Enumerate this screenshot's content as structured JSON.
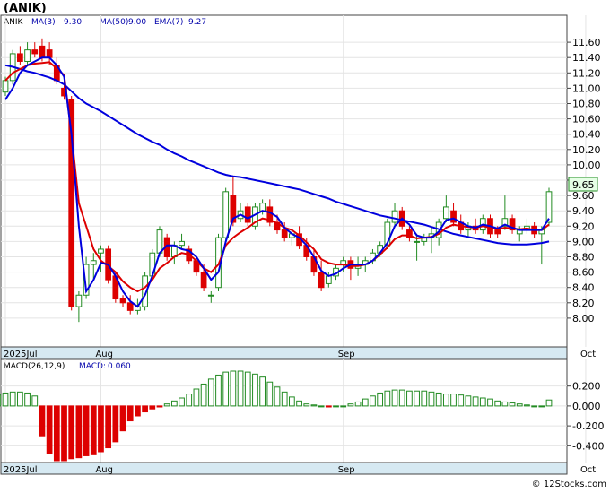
{
  "header": {
    "ticker": "(ANIK)",
    "legend": [
      {
        "text": "ANIK",
        "color": "#000000"
      },
      {
        "text": "MA(3)",
        "color": "#0000aa"
      },
      {
        "text": "9.30",
        "color": "#0000aa"
      },
      {
        "text": "MA(50)",
        "color": "#0000aa"
      },
      {
        "text": "9.00",
        "color": "#0000aa"
      },
      {
        "text": "EMA(7)",
        "color": "#0000aa"
      },
      {
        "text": "9.27",
        "color": "#0000aa"
      }
    ],
    "last_price_label": "9.65"
  },
  "footer": {
    "credit": "© 12Stocks.com"
  },
  "colors": {
    "up": "#228b22",
    "down": "#dd0000",
    "ma50": "#0000dd",
    "ema7": "#dd0000",
    "ma3": "#0000dd",
    "macd_pos": "#228b22",
    "macd_neg": "#dd0000",
    "axis_band": "#d6e9f2"
  },
  "chart_data": [
    {
      "type": "candlestick",
      "title": "ANIK",
      "ylim": [
        7.8,
        11.8
      ],
      "y_ticks": [
        "11.60",
        "11.40",
        "11.20",
        "11.00",
        "10.80",
        "10.60",
        "10.40",
        "10.20",
        "10.00",
        "9.80",
        "9.60",
        "9.40",
        "9.20",
        "9.00",
        "8.80",
        "8.60",
        "8.40",
        "8.20",
        "8.00"
      ],
      "x_labels": [
        {
          "label": "2025Jul",
          "index": 0
        },
        {
          "label": "Aug",
          "index": 13
        },
        {
          "label": "Sep",
          "index": 46
        },
        {
          "label": "Oct",
          "index": 79
        }
      ],
      "series": [
        {
          "name": "ANIK",
          "candles": [
            [
              10.95,
              11.15,
              10.9,
              11.1
            ],
            [
              11.1,
              11.5,
              11.05,
              11.45
            ],
            [
              11.45,
              11.55,
              11.3,
              11.35
            ],
            [
              11.35,
              11.6,
              11.3,
              11.5
            ],
            [
              11.5,
              11.6,
              11.4,
              11.45
            ],
            [
              11.55,
              11.65,
              11.35,
              11.4
            ],
            [
              11.5,
              11.6,
              11.3,
              11.4
            ],
            [
              11.3,
              11.4,
              11.05,
              11.1
            ],
            [
              11.0,
              11.1,
              10.85,
              10.9
            ],
            [
              10.85,
              10.9,
              8.1,
              8.15
            ],
            [
              8.15,
              8.35,
              7.95,
              8.3
            ],
            [
              8.3,
              8.8,
              8.25,
              8.7
            ],
            [
              8.7,
              8.85,
              8.5,
              8.75
            ],
            [
              8.85,
              8.95,
              8.6,
              8.9
            ],
            [
              8.9,
              8.95,
              8.45,
              8.5
            ],
            [
              8.55,
              8.6,
              8.2,
              8.25
            ],
            [
              8.25,
              8.3,
              8.15,
              8.2
            ],
            [
              8.2,
              8.3,
              8.05,
              8.1
            ],
            [
              8.1,
              8.25,
              8.05,
              8.15
            ],
            [
              8.15,
              8.6,
              8.1,
              8.55
            ],
            [
              8.55,
              8.9,
              8.5,
              8.85
            ],
            [
              8.85,
              9.2,
              8.8,
              9.15
            ],
            [
              9.05,
              9.1,
              8.75,
              8.8
            ],
            [
              8.8,
              9.0,
              8.7,
              8.95
            ],
            [
              8.95,
              9.1,
              8.9,
              9.0
            ],
            [
              8.9,
              8.95,
              8.7,
              8.75
            ],
            [
              8.75,
              8.8,
              8.55,
              8.6
            ],
            [
              8.6,
              8.7,
              8.35,
              8.4
            ],
            [
              8.3,
              8.35,
              8.2,
              8.3
            ],
            [
              8.4,
              9.1,
              8.35,
              9.05
            ],
            [
              9.05,
              9.7,
              9.0,
              9.65
            ],
            [
              9.6,
              9.85,
              9.2,
              9.25
            ],
            [
              9.3,
              9.5,
              9.25,
              9.4
            ],
            [
              9.45,
              9.5,
              9.2,
              9.25
            ],
            [
              9.2,
              9.5,
              9.15,
              9.45
            ],
            [
              9.4,
              9.55,
              9.35,
              9.5
            ],
            [
              9.45,
              9.55,
              9.2,
              9.25
            ],
            [
              9.25,
              9.35,
              9.1,
              9.15
            ],
            [
              9.15,
              9.25,
              9.0,
              9.05
            ],
            [
              9.05,
              9.15,
              8.95,
              9.1
            ],
            [
              9.1,
              9.2,
              8.9,
              8.95
            ],
            [
              8.95,
              9.05,
              8.75,
              8.8
            ],
            [
              8.8,
              8.9,
              8.55,
              8.6
            ],
            [
              8.6,
              8.75,
              8.35,
              8.4
            ],
            [
              8.45,
              8.6,
              8.4,
              8.55
            ],
            [
              8.55,
              8.7,
              8.5,
              8.65
            ],
            [
              8.7,
              8.8,
              8.6,
              8.75
            ],
            [
              8.75,
              8.8,
              8.5,
              8.65
            ],
            [
              8.65,
              8.8,
              8.55,
              8.7
            ],
            [
              8.7,
              8.8,
              8.6,
              8.75
            ],
            [
              8.75,
              8.9,
              8.7,
              8.85
            ],
            [
              8.85,
              9.0,
              8.8,
              8.95
            ],
            [
              8.95,
              9.3,
              8.9,
              9.25
            ],
            [
              9.25,
              9.5,
              9.2,
              9.4
            ],
            [
              9.4,
              9.45,
              9.15,
              9.2
            ],
            [
              9.15,
              9.2,
              9.0,
              9.05
            ],
            [
              9.0,
              9.1,
              8.75,
              9.0
            ],
            [
              9.0,
              9.1,
              8.95,
              9.05
            ],
            [
              9.05,
              9.2,
              8.85,
              9.1
            ],
            [
              9.05,
              9.3,
              8.95,
              9.25
            ],
            [
              9.3,
              9.6,
              9.25,
              9.45
            ],
            [
              9.4,
              9.5,
              9.2,
              9.25
            ],
            [
              9.25,
              9.35,
              9.1,
              9.15
            ],
            [
              9.15,
              9.25,
              9.05,
              9.2
            ],
            [
              9.2,
              9.3,
              9.1,
              9.15
            ],
            [
              9.15,
              9.35,
              9.1,
              9.3
            ],
            [
              9.3,
              9.35,
              9.05,
              9.1
            ],
            [
              9.15,
              9.2,
              9.05,
              9.1
            ],
            [
              9.2,
              9.6,
              9.15,
              9.3
            ],
            [
              9.3,
              9.35,
              9.1,
              9.15
            ],
            [
              9.1,
              9.2,
              9.0,
              9.15
            ],
            [
              9.15,
              9.3,
              9.1,
              9.2
            ],
            [
              9.2,
              9.25,
              9.05,
              9.1
            ],
            [
              9.1,
              9.2,
              8.7,
              9.15
            ],
            [
              9.25,
              9.7,
              9.2,
              9.65
            ]
          ]
        },
        {
          "name": "MA(50)",
          "values": [
            11.3,
            11.28,
            11.25,
            11.22,
            11.2,
            11.17,
            11.14,
            11.1,
            11.05,
            10.96,
            10.87,
            10.8,
            10.75,
            10.7,
            10.64,
            10.58,
            10.52,
            10.46,
            10.4,
            10.35,
            10.3,
            10.26,
            10.2,
            10.15,
            10.11,
            10.06,
            10.02,
            9.98,
            9.94,
            9.9,
            9.87,
            9.85,
            9.84,
            9.82,
            9.8,
            9.78,
            9.76,
            9.74,
            9.72,
            9.7,
            9.68,
            9.65,
            9.62,
            9.59,
            9.56,
            9.52,
            9.49,
            9.46,
            9.43,
            9.4,
            9.37,
            9.34,
            9.32,
            9.3,
            9.28,
            9.26,
            9.24,
            9.22,
            9.19,
            9.16,
            9.13,
            9.1,
            9.08,
            9.06,
            9.04,
            9.02,
            9.0,
            8.98,
            8.97,
            8.96,
            8.96,
            8.96,
            8.97,
            8.98,
            9.0
          ]
        },
        {
          "name": "EMA(7)",
          "values": [
            11.1,
            11.2,
            11.25,
            11.3,
            11.32,
            11.33,
            11.34,
            11.26,
            11.17,
            10.4,
            9.5,
            9.2,
            8.9,
            8.75,
            8.68,
            8.6,
            8.48,
            8.4,
            8.35,
            8.4,
            8.5,
            8.65,
            8.72,
            8.8,
            8.85,
            8.83,
            8.75,
            8.65,
            8.6,
            8.7,
            8.95,
            9.05,
            9.12,
            9.18,
            9.25,
            9.3,
            9.28,
            9.24,
            9.18,
            9.15,
            9.08,
            8.99,
            8.9,
            8.77,
            8.72,
            8.7,
            8.7,
            8.68,
            8.68,
            8.7,
            8.75,
            8.83,
            8.92,
            9.03,
            9.08,
            9.08,
            9.04,
            9.05,
            9.06,
            9.1,
            9.18,
            9.22,
            9.2,
            9.19,
            9.18,
            9.2,
            9.18,
            9.16,
            9.18,
            9.17,
            9.16,
            9.17,
            9.15,
            9.15,
            9.22
          ]
        },
        {
          "name": "MA(3)",
          "values": [
            10.85,
            11.0,
            11.2,
            11.3,
            11.35,
            11.4,
            11.4,
            11.3,
            11.15,
            10.4,
            9.2,
            8.35,
            8.5,
            8.72,
            8.7,
            8.55,
            8.35,
            8.22,
            8.15,
            8.3,
            8.55,
            8.85,
            8.95,
            8.95,
            8.9,
            8.88,
            8.8,
            8.65,
            8.5,
            8.6,
            9.0,
            9.3,
            9.35,
            9.3,
            9.35,
            9.4,
            9.38,
            9.32,
            9.18,
            9.1,
            9.05,
            8.95,
            8.8,
            8.62,
            8.55,
            8.58,
            8.65,
            8.7,
            8.7,
            8.7,
            8.75,
            8.85,
            8.98,
            9.2,
            9.3,
            9.22,
            9.08,
            9.05,
            9.05,
            9.13,
            9.28,
            9.3,
            9.25,
            9.2,
            9.18,
            9.22,
            9.2,
            9.17,
            9.22,
            9.18,
            9.15,
            9.15,
            9.15,
            9.15,
            9.3
          ]
        }
      ]
    },
    {
      "type": "bar",
      "title": "MACD(26,12,9)",
      "legend_label": "MACD:",
      "legend_value": "0.060",
      "ylim": [
        -0.55,
        0.35
      ],
      "y_ticks": [
        "0.200",
        "0.000",
        "-0.200",
        "-0.400"
      ],
      "x_labels": [
        {
          "label": "2025Jul",
          "index": 0
        },
        {
          "label": "Aug",
          "index": 13
        },
        {
          "label": "Sep",
          "index": 46
        },
        {
          "label": "Oct",
          "index": 79
        }
      ],
      "values": [
        0.03,
        0.06,
        0.09,
        0.11,
        0.13,
        0.14,
        0.14,
        0.13,
        0.1,
        -0.3,
        -0.48,
        -0.55,
        -0.55,
        -0.53,
        -0.52,
        -0.5,
        -0.49,
        -0.46,
        -0.42,
        -0.36,
        -0.25,
        -0.15,
        -0.1,
        -0.06,
        -0.03,
        -0.01,
        0.02,
        0.05,
        0.08,
        0.12,
        0.17,
        0.22,
        0.27,
        0.31,
        0.34,
        0.35,
        0.35,
        0.34,
        0.32,
        0.29,
        0.24,
        0.19,
        0.14,
        0.09,
        0.05,
        0.02,
        0.01,
        0.0,
        -0.01,
        0.0,
        0.0,
        0.02,
        0.04,
        0.07,
        0.1,
        0.13,
        0.15,
        0.16,
        0.16,
        0.15,
        0.15,
        0.15,
        0.14,
        0.13,
        0.12,
        0.12,
        0.11,
        0.1,
        0.09,
        0.08,
        0.07,
        0.05,
        0.04,
        0.03,
        0.02,
        0.01,
        0.0,
        0.0,
        0.06
      ]
    }
  ]
}
